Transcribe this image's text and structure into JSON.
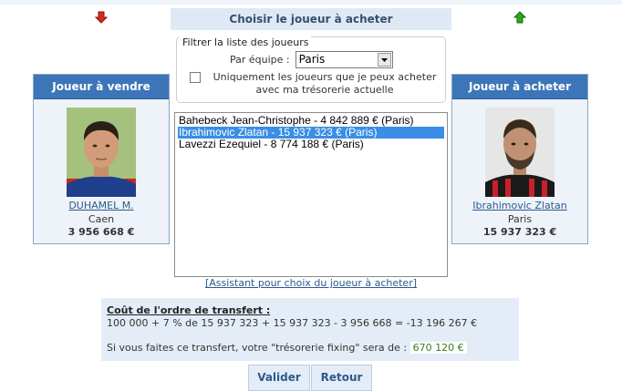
{
  "header": {
    "title": "Choisir le joueur à acheter"
  },
  "arrows": {
    "left": "red-down-arrow",
    "right": "green-up-arrow",
    "left_color": "#d42a1a",
    "right_color": "#2fa61f"
  },
  "filter": {
    "legend": "Filtrer la liste des joueurs",
    "team_label": "Par équipe :",
    "team_value": "Paris",
    "checkbox_line1": "Uniquement les joueurs que je peux acheter",
    "checkbox_line2": "avec ma trésorerie actuelle",
    "checkbox_checked": false
  },
  "sell_card": {
    "header": "Joueur à vendre",
    "name": "DUHAMEL M.",
    "club": "Caen",
    "value": "3 956 668 €"
  },
  "buy_card": {
    "header": "Joueur à acheter",
    "name": "Ibrahimovic Zlatan",
    "club": "Paris",
    "value": "15 937 323 €"
  },
  "players": [
    "Bahebeck Jean-Christophe - 4 842 889 € (Paris)",
    "Ibrahimovic Zlatan - 15 937 323 € (Paris)",
    "Lavezzi Ezequiel - 8 774 188 € (Paris)"
  ],
  "selected_index": 1,
  "assistant_link": "[Assistant pour choix du joueur à acheter]",
  "cost": {
    "title": "Coût de l'ordre de transfert :",
    "formula": "100 000 + 7 % de 15 937 323 + 15 937 323 - 3 956 668 = -13 196 267 €",
    "fixing_text": "Si vous faites ce transfert, votre \"trésorerie fixing\" sera de :",
    "fixing_value": "670 120 €"
  },
  "buttons": {
    "validate": "Valider",
    "back": "Retour"
  }
}
